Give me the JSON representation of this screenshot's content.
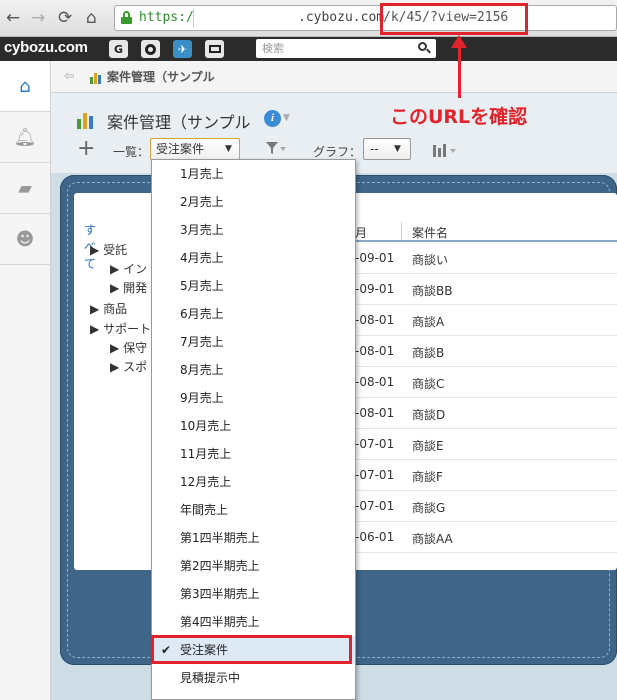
{
  "browser": {
    "url_scheme": "https://",
    "url_domain": ".cybozu.com",
    "url_path": "/k/45/?view=2156",
    "url_path_prefix": ""
  },
  "header": {
    "logo": "cybozu.com",
    "search_placeholder": "検索"
  },
  "breadcrumb": {
    "app_label": "案件管理（サンプル"
  },
  "page": {
    "title": "案件管理（サンプル",
    "list_label": "一覧：",
    "selected_view": "受注案件",
    "graph_label": "グラフ：",
    "graph_value": "--"
  },
  "tree": {
    "all": "すべて",
    "items": [
      {
        "label": "受託",
        "expand": "▶"
      },
      {
        "label": "イン",
        "expand": "▶"
      },
      {
        "label": "開発",
        "expand": "▶"
      },
      {
        "label": "商品",
        "expand": "▶"
      },
      {
        "label": "サポート",
        "expand": "▶"
      },
      {
        "label": "保守",
        "expand": "▶"
      },
      {
        "label": "スポ",
        "expand": "▶"
      }
    ]
  },
  "table": {
    "col_date": "月",
    "col_name": "案件名",
    "rows": [
      {
        "date": "-09-01",
        "name": "商談い"
      },
      {
        "date": "-09-01",
        "name": "商談BB"
      },
      {
        "date": "-08-01",
        "name": "商談A"
      },
      {
        "date": "-08-01",
        "name": "商談B"
      },
      {
        "date": "-08-01",
        "name": "商談C"
      },
      {
        "date": "-08-01",
        "name": "商談D"
      },
      {
        "date": "-07-01",
        "name": "商談E"
      },
      {
        "date": "-07-01",
        "name": "商談F"
      },
      {
        "date": "-07-01",
        "name": "商談G"
      },
      {
        "date": "-06-01",
        "name": "商談AA"
      }
    ]
  },
  "dropdown": {
    "check_mark": "✔",
    "items": [
      "1月売上",
      "2月売上",
      "3月売上",
      "4月売上",
      "5月売上",
      "6月売上",
      "7月売上",
      "8月売上",
      "9月売上",
      "10月売上",
      "11月売上",
      "12月売上",
      "年間売上",
      "第1四半期売上",
      "第2四半期売上",
      "第3四半期売上",
      "第4四半期売上",
      "受注案件",
      "見積提示中"
    ],
    "selected_index": 17
  },
  "annotation": {
    "text": "このURLを確認",
    "color": "#e3232b"
  }
}
